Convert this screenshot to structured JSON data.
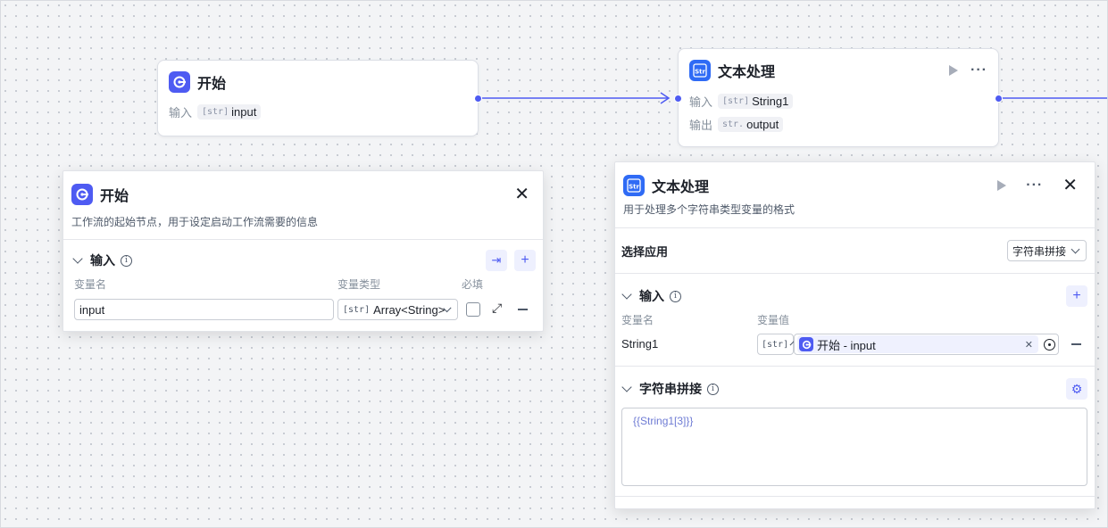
{
  "start_node": {
    "title": "开始",
    "input_label": "输入",
    "input_type": "[str]",
    "input_name": "input"
  },
  "text_node": {
    "title": "文本处理",
    "input_label": "输入",
    "input_type": "[str]",
    "input_name": "String1",
    "output_label": "输出",
    "output_type": "str.",
    "output_name": "output"
  },
  "start_panel": {
    "title": "开始",
    "description": "工作流的起始节点，用于设定启动工作流需要的信息",
    "section_title": "输入",
    "col_name": "变量名",
    "col_type": "变量类型",
    "col_required": "必填",
    "var_name_value": "input",
    "var_type_tag": "[str]",
    "var_type_value": "Array<String>"
  },
  "text_panel": {
    "title": "文本处理",
    "description": "用于处理多个字符串类型变量的格式",
    "select_app_label": "选择应用",
    "select_app_value": "字符串拼接",
    "input_section_title": "输入",
    "col_name": "变量名",
    "col_value": "变量值",
    "var_name": "String1",
    "var_type_tag": "[str]",
    "ref_value": "开始 - input",
    "concat_section_title": "字符串拼接",
    "template": "{{String1[3]}}"
  },
  "colors": {
    "accent": "#4e5bf2",
    "text_app": "#2f6bf5"
  },
  "icons": {
    "start": "start-icon",
    "text_processing": "str-icon",
    "run": "play-icon",
    "more": "more-icon",
    "close": "close-icon",
    "info": "info-icon",
    "add": "plus-icon",
    "import": "import-icon",
    "expand": "expand-icon",
    "remove": "minus-icon",
    "settings": "gear-icon",
    "clear": "clear-icon",
    "pick": "target-icon"
  }
}
